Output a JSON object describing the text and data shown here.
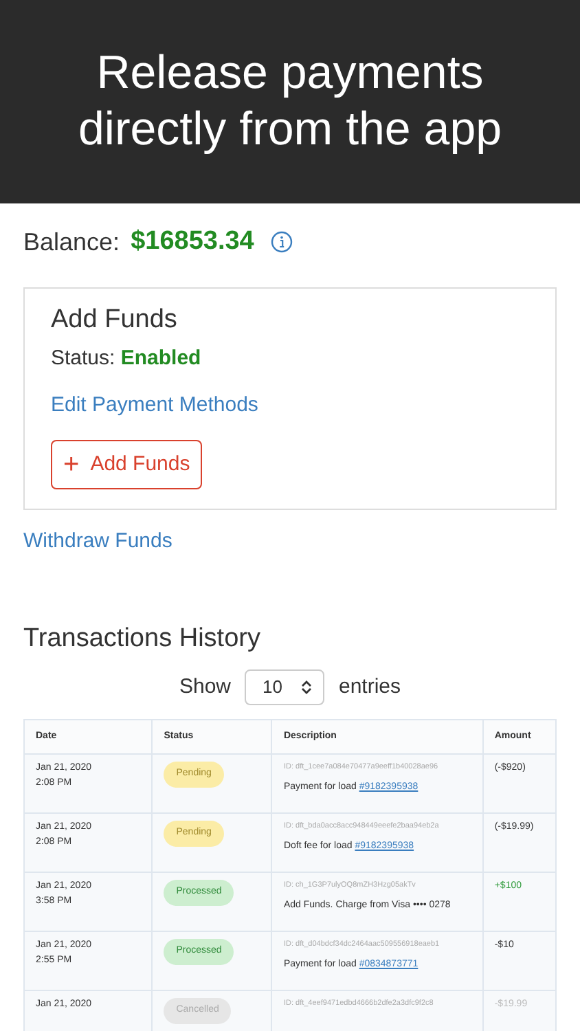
{
  "banner": {
    "headline": "Release payments directly from the app"
  },
  "balance": {
    "label": "Balance:",
    "amount": "$16853.34"
  },
  "add_funds_card": {
    "title": "Add Funds",
    "status_label": "Status:",
    "status_value": "Enabled",
    "edit_link": "Edit Payment Methods",
    "button": {
      "icon": "+",
      "label": "Add Funds"
    }
  },
  "withdraw_link": "Withdraw Funds",
  "history": {
    "title": "Transactions History",
    "show_label": "Show",
    "page_size": "10",
    "entries_label": "entries",
    "table": {
      "columns": [
        "Date",
        "Status",
        "Description",
        "Amount"
      ],
      "rows": [
        {
          "date": "Jan 21, 2020",
          "time": "2:08 PM",
          "status": {
            "label": "Pending",
            "kind": "pending"
          },
          "id": "ID: dft_1cee7a084e70477a9eeff1b40028ae96",
          "description": "Payment for load",
          "link": "#9182395938",
          "amount": {
            "text": "(-$920)",
            "kind": "debit"
          }
        },
        {
          "date": "Jan 21, 2020",
          "time": "2:08 PM",
          "status": {
            "label": "Pending",
            "kind": "pending"
          },
          "id": "ID: dft_bda0acc8acc948449eeefe2baa94eb2a",
          "description": "Doft fee for load",
          "link": "#9182395938",
          "amount": {
            "text": "(-$19.99)",
            "kind": "debit"
          }
        },
        {
          "date": "Jan 21, 2020",
          "time": "3:58 PM",
          "status": {
            "label": "Processed",
            "kind": "processed"
          },
          "id": "ID: ch_1G3P7ulyOQ8mZH3Hzg05akTv",
          "description": "Add Funds. Charge from Visa •••• 0278",
          "amount": {
            "text": "+$100",
            "kind": "credit"
          }
        },
        {
          "date": "Jan 21, 2020",
          "time": "2:55 PM",
          "status": {
            "label": "Processed",
            "kind": "processed"
          },
          "id": "ID: dft_d04bdcf34dc2464aac509556918eaeb1",
          "description": "Payment for load",
          "link": "#0834873771",
          "amount": {
            "text": "-$10",
            "kind": "debit"
          }
        },
        {
          "date": "Jan 21, 2020",
          "status": {
            "label": "Cancelled",
            "kind": "cancelled"
          },
          "id": "ID: dft_4eef9471edbd4666b2dfe2a3dfc9f2c8",
          "amount": {
            "text": "-$19.99",
            "kind": "void"
          }
        }
      ]
    }
  }
}
